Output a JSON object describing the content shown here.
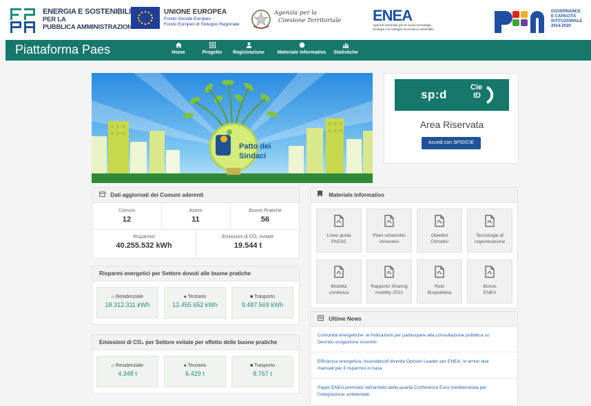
{
  "header": {
    "fespa_line1": "ENERGIA E SOSTENIBILITÀ",
    "fespa_line2": "PER LA",
    "fespa_line3": "PUBBLICA AMMINISTRAZIONE",
    "eu_title": "UNIONE EUROPEA",
    "eu_line2": "Fondo Sociale Europeo",
    "eu_line3": "Fondo Europeo di Sviluppo Regionale",
    "agency_line1": "Agenzia per la",
    "agency_line2": "Coesione Territoriale",
    "enea_word": "ENEA",
    "enea_sub1": "Agenzia nazionale per le nuove tecnologie,",
    "enea_sub2": "l'energia e lo sviluppo economico sostenibile",
    "pon_line1": "GOVERNANCE",
    "pon_line2": "E CAPACITÀ",
    "pon_line3": "ISTITUZIONALE",
    "pon_line4": "2014-2020"
  },
  "nav": {
    "brand": "Piattaforma Paes",
    "items": [
      {
        "label": "Home",
        "icon": "home-icon"
      },
      {
        "label": "Progetto",
        "icon": "list-icon"
      },
      {
        "label": "Registrazione",
        "icon": "user-icon"
      },
      {
        "label": "Materiale Informativo",
        "icon": "circle-icon"
      },
      {
        "label": "Statistiche",
        "icon": "bar-chart-icon"
      }
    ]
  },
  "hero": {
    "caption_line1": "Patto dei",
    "caption_line2": "Sindaci"
  },
  "login": {
    "spid_word": "sp:d",
    "cie_line1": "Cie",
    "cie_line2": "ID",
    "area_title": "Area Riservata",
    "button_label": "Accedi con SPID/CIE"
  },
  "dati": {
    "title": "Dati aggiornati dei Comuni aderenti",
    "comuni_label": "Comuni",
    "comuni_value": "12",
    "azioni_label": "Azioni",
    "azioni_value": "11",
    "pratiche_label": "Buone Pratiche",
    "pratiche_value": "56",
    "risparmio_label": "Risparmio",
    "risparmio_value": "40.255.532 kWh",
    "emissioni_label": "Emissioni di CO₂ evitate",
    "emissioni_value": "19.544 t"
  },
  "risparmi": {
    "title": "Risparmi energetici per Settore dovuti alle buone pratiche",
    "sectors": [
      {
        "label": "Residenziale",
        "value": "18.312.311 kWh"
      },
      {
        "label": "Terziario",
        "value": "12.455.652 kWh"
      },
      {
        "label": "Trasporto",
        "value": "9.487.569 kWh"
      }
    ]
  },
  "emissioni": {
    "title": "Emissioni di CO₂ per Settore evitate per effetto delle buone pratiche",
    "sectors": [
      {
        "label": "Residenziale",
        "value": "4.348 t"
      },
      {
        "label": "Terziario",
        "value": "6.429 t"
      },
      {
        "label": "Trasporto",
        "value": "8.767 t"
      }
    ]
  },
  "materiale": {
    "title": "Materiale informativo",
    "tiles": [
      {
        "l1": "Linee guida",
        "l2": "PAESC"
      },
      {
        "l1": "Piani urbanistici",
        "l2": "innovativi"
      },
      {
        "l1": "Obiettivi",
        "l2": "Climatici"
      },
      {
        "l1": "Tecnologie di",
        "l2": "cogenerazione"
      },
      {
        "l1": "Mobilità",
        "l2": "condivisa"
      },
      {
        "l1": "Rapporto Sharing",
        "l2": "mobility 2022"
      },
      {
        "l1": "Rete",
        "l2": "Bicipolitana"
      },
      {
        "l1": "Bonus",
        "l2": "ENEA"
      }
    ]
  },
  "news": {
    "title": "Ultime News",
    "items": [
      {
        "l1": "Comunità energetiche: le Indicazioni per partecipare alla consultazione pubblica su",
        "l2": "Decreto erogazione incentivi"
      },
      {
        "l1": "Efficienza energetica, Assindatcolf diventa Opinion Leader per ENEA: in arrivo due",
        "l2": "manuali per il risparmio in casa"
      },
      {
        "l1": "Paper ENEA premiato nell'ambito della quarta Conferenza Euro-mediterranea per",
        "l2": "l'integrazione ambientale"
      }
    ]
  },
  "colors": {
    "nav": "#16776b",
    "accent": "#1e8c7d",
    "button": "#1f5396",
    "link": "#1f5fb0"
  }
}
